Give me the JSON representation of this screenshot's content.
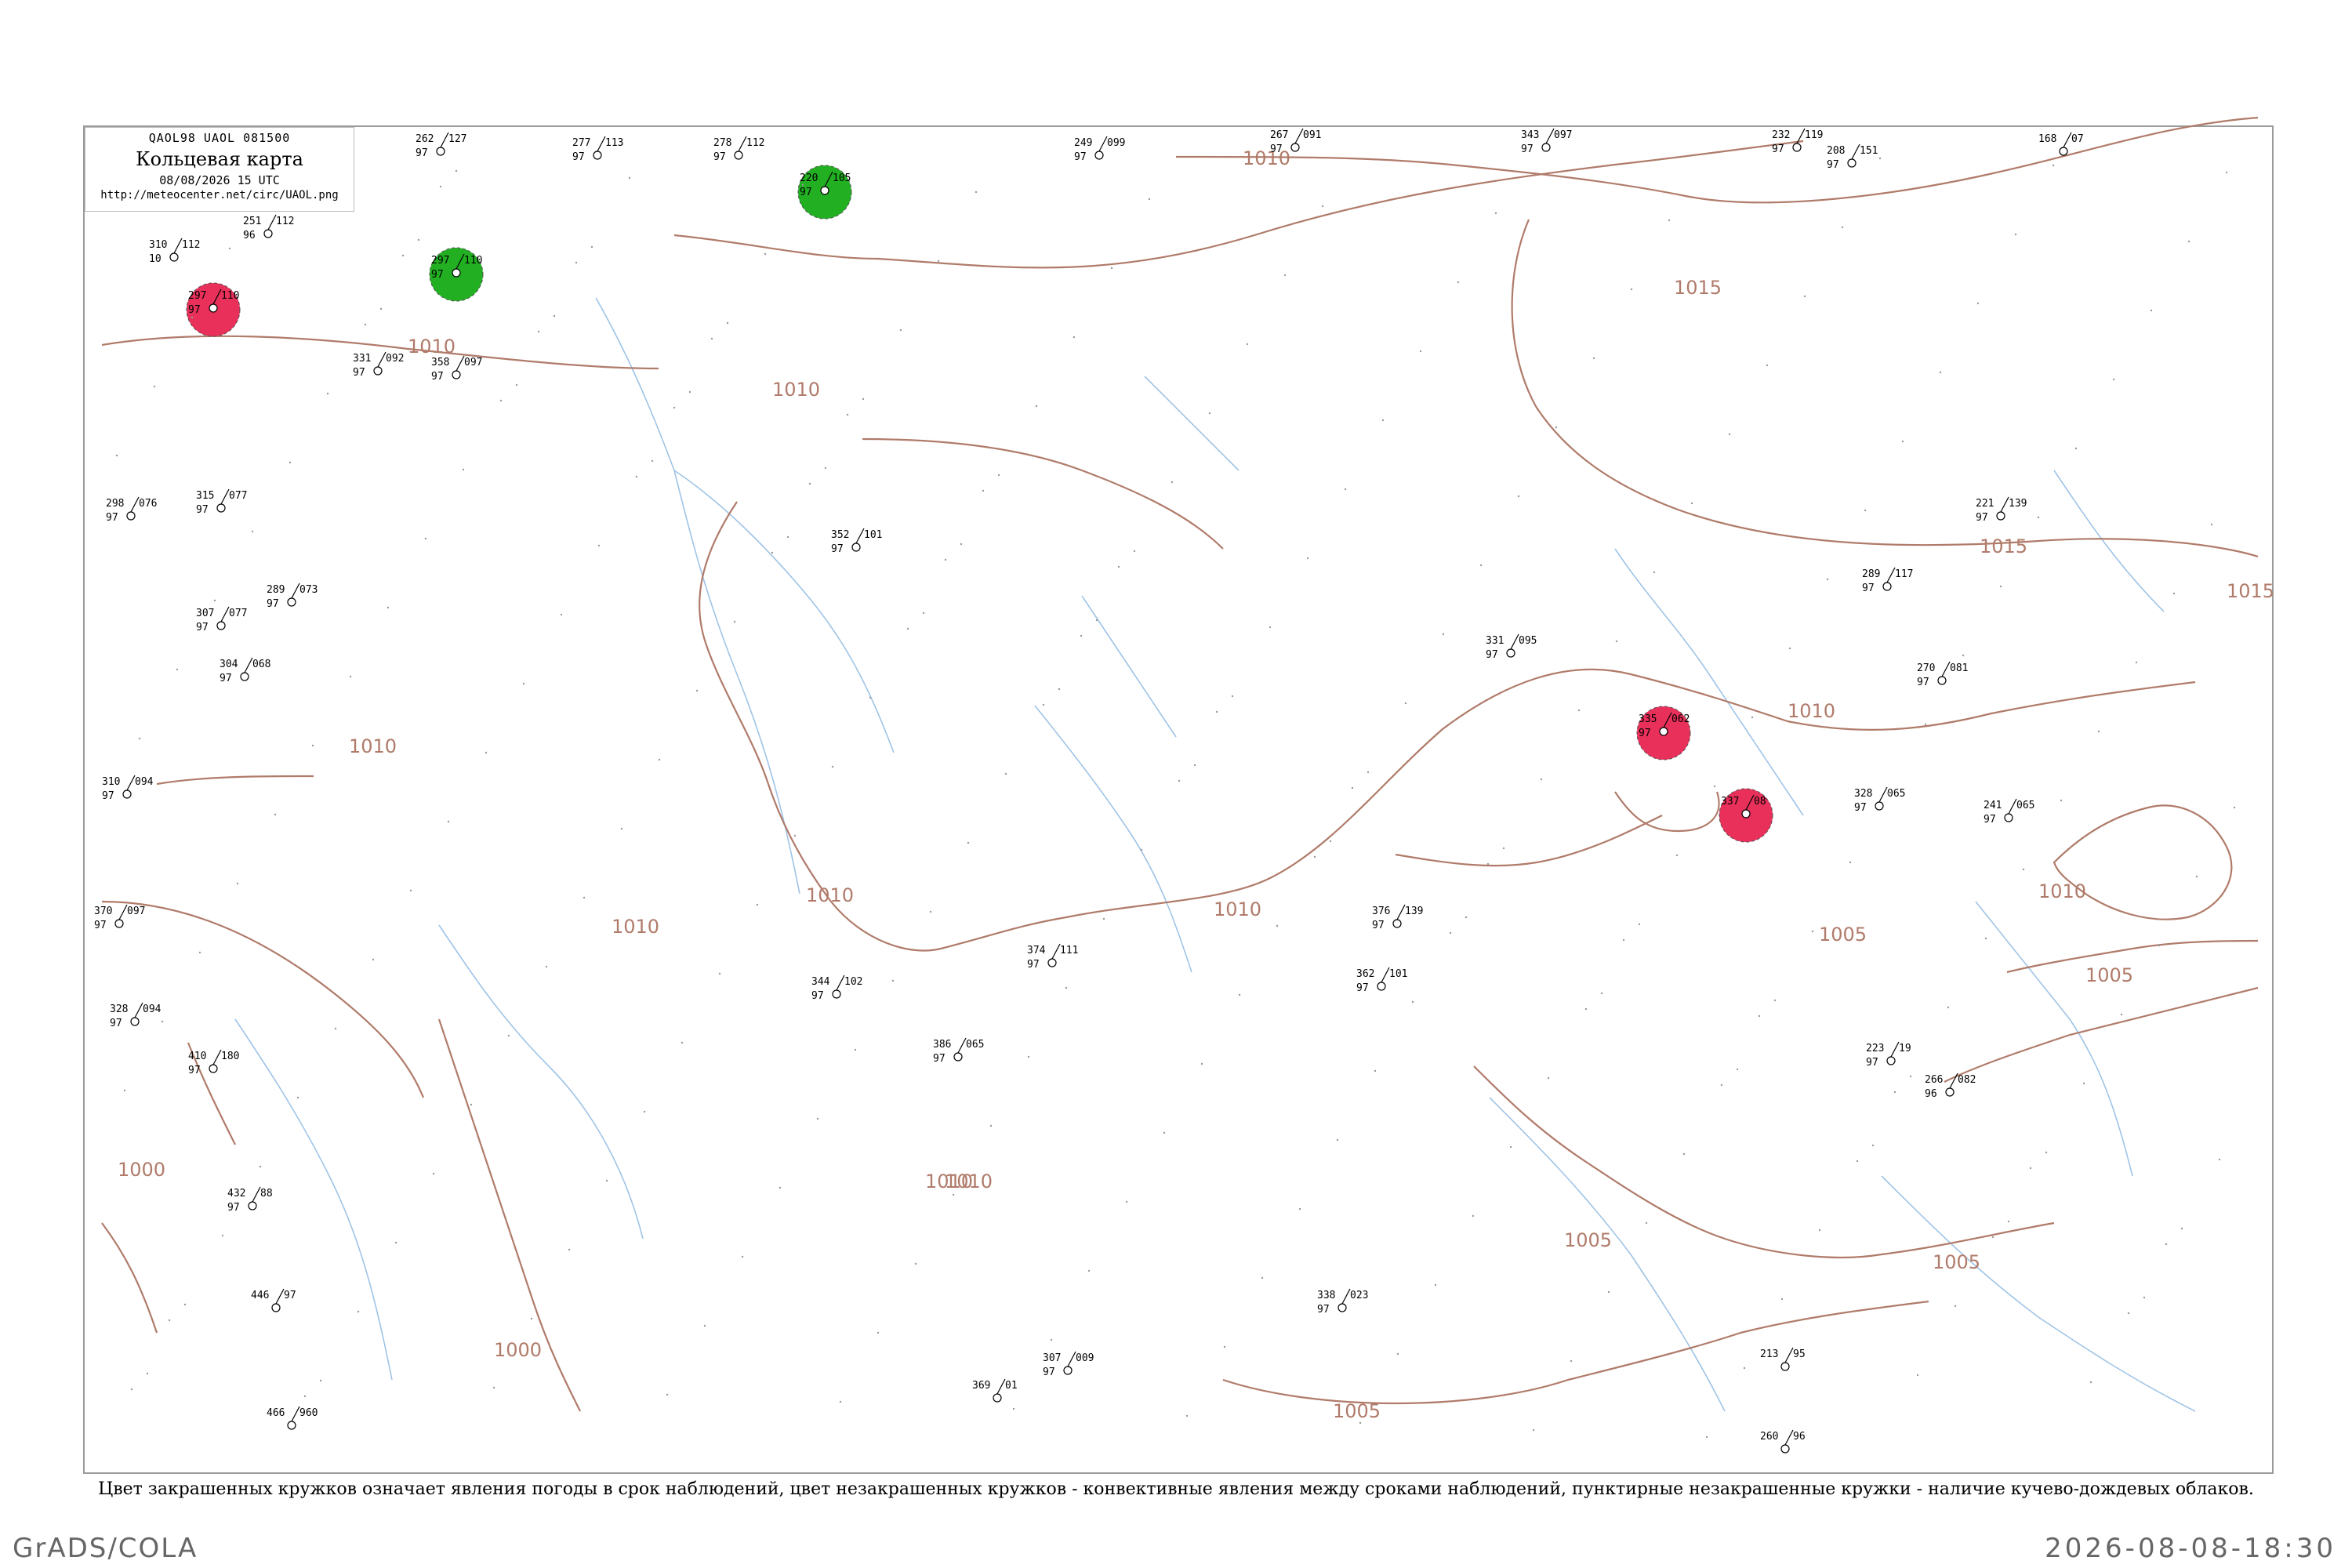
{
  "header": {
    "codes": "QAOL98  UAOL  081500",
    "title": "Кольцевая карта",
    "datetime": "08/08/2026 15 UTC",
    "url": "http://meteocenter.net/circ/UAOL.png"
  },
  "caption": "Цвет закрашенных кружков означает явления погоды в срок наблюдений, цвет незакрашенных кружков - конвективные явления между сроками наблюдений, пунктирные незакрашенные кружки - наличие кучево-дождевых облаков.",
  "footer": {
    "left": "GrADS/COLA",
    "right": "2026-08-08-18:30"
  },
  "colors": {
    "isobar": "#b07b6a",
    "river": "#9fc4e6",
    "border": "#999999",
    "thunder_fill": "#e8305a",
    "rain_fill": "#22b022",
    "cb_circle": "#22b022",
    "conv_circle": "#d84a6a"
  },
  "isobars": [
    {
      "label": "1010"
    },
    {
      "label": "1010"
    },
    {
      "label": "1010"
    },
    {
      "label": "1010"
    },
    {
      "label": "1010"
    },
    {
      "label": "1010"
    },
    {
      "label": "1010"
    },
    {
      "label": "1010"
    },
    {
      "label": "1015"
    },
    {
      "label": "1015"
    },
    {
      "label": "1015"
    },
    {
      "label": "1010"
    },
    {
      "label": "1005"
    },
    {
      "label": "1005"
    },
    {
      "label": "1005"
    },
    {
      "label": "1005"
    },
    {
      "label": "1005"
    },
    {
      "label": "1000"
    },
    {
      "label": "1000"
    },
    {
      "label": "1010"
    },
    {
      "label": "1010"
    }
  ],
  "stations": [
    {
      "p": "310",
      "t": "112",
      "td": "10",
      "name": "",
      "wx": "none"
    },
    {
      "p": "251",
      "t": "112",
      "td": "96",
      "name": "",
      "wx": "none"
    },
    {
      "p": "297",
      "t": "110",
      "td": "97",
      "name": "",
      "wx": "thunder"
    },
    {
      "p": "262",
      "t": "127",
      "td": "97",
      "name": "",
      "wx": "none"
    },
    {
      "p": "277",
      "t": "113",
      "td": "97",
      "name": "",
      "wx": "none"
    },
    {
      "p": "297",
      "t": "110",
      "td": "97",
      "name": "",
      "wx": "rain"
    },
    {
      "p": "278",
      "t": "112",
      "td": "97",
      "name": "",
      "wx": "none"
    },
    {
      "p": "220",
      "t": "105",
      "td": "97",
      "name": "",
      "wx": "rain"
    },
    {
      "p": "249",
      "t": "099",
      "td": "97",
      "name": "",
      "wx": "none"
    },
    {
      "p": "267",
      "t": "091",
      "td": "97",
      "name": "",
      "wx": "none"
    },
    {
      "p": "343",
      "t": "097",
      "td": "97",
      "name": "",
      "wx": "none"
    },
    {
      "p": "232",
      "t": "119",
      "td": "97",
      "name": "",
      "wx": "none"
    },
    {
      "p": "208",
      "t": "151",
      "td": "97",
      "name": "",
      "wx": "none"
    },
    {
      "p": "168",
      "t": "07",
      "td": "",
      "name": "",
      "wx": "none"
    },
    {
      "p": "331",
      "t": "092",
      "td": "97",
      "name": "",
      "wx": "none"
    },
    {
      "p": "358",
      "t": "097",
      "td": "97",
      "name": "",
      "wx": "none"
    },
    {
      "p": "298",
      "t": "076",
      "td": "97",
      "name": "",
      "wx": "none"
    },
    {
      "p": "315",
      "t": "077",
      "td": "97",
      "name": "",
      "wx": "none"
    },
    {
      "p": "289",
      "t": "073",
      "td": "97",
      "name": "",
      "wx": "none"
    },
    {
      "p": "307",
      "t": "077",
      "td": "97",
      "name": "",
      "wx": "none"
    },
    {
      "p": "304",
      "t": "068",
      "td": "97",
      "name": "",
      "wx": "none"
    },
    {
      "p": "310",
      "t": "094",
      "td": "97",
      "name": "",
      "wx": "none"
    },
    {
      "p": "328",
      "t": "094",
      "td": "97",
      "name": "",
      "wx": "none"
    },
    {
      "p": "370",
      "t": "097",
      "td": "97",
      "name": "",
      "wx": "none"
    },
    {
      "p": "410",
      "t": "180",
      "td": "97",
      "name": "",
      "wx": "none"
    },
    {
      "p": "432",
      "t": "88",
      "td": "97",
      "name": "",
      "wx": "none"
    },
    {
      "p": "446",
      "t": "97",
      "td": "",
      "name": "",
      "wx": "none"
    },
    {
      "p": "466",
      "t": "960",
      "td": "",
      "name": "",
      "wx": "none"
    },
    {
      "p": "352",
      "t": "101",
      "td": "97",
      "name": "",
      "wx": "none"
    },
    {
      "p": "344",
      "t": "102",
      "td": "97",
      "name": "",
      "wx": "none"
    },
    {
      "p": "386",
      "t": "065",
      "td": "97",
      "name": "",
      "wx": "none"
    },
    {
      "p": "369",
      "t": "01",
      "td": "",
      "name": "",
      "wx": "none"
    },
    {
      "p": "307",
      "t": "009",
      "td": "97",
      "name": "",
      "wx": "none"
    },
    {
      "p": "374",
      "t": "111",
      "td": "97",
      "name": "",
      "wx": "none"
    },
    {
      "p": "362",
      "t": "101",
      "td": "97",
      "name": "",
      "wx": "none"
    },
    {
      "p": "376",
      "t": "139",
      "td": "97",
      "name": "",
      "wx": "none"
    },
    {
      "p": "338",
      "t": "023",
      "td": "97",
      "name": "",
      "wx": "none"
    },
    {
      "p": "331",
      "t": "095",
      "td": "97",
      "name": "",
      "wx": "none"
    },
    {
      "p": "335",
      "t": "062",
      "td": "97",
      "name": "",
      "wx": "thunder"
    },
    {
      "p": "337",
      "t": "08",
      "td": "",
      "name": "",
      "wx": "thunder"
    },
    {
      "p": "328",
      "t": "065",
      "td": "97",
      "name": "",
      "wx": "none"
    },
    {
      "p": "270",
      "t": "081",
      "td": "97",
      "name": "",
      "wx": "none"
    },
    {
      "p": "241",
      "t": "065",
      "td": "97",
      "name": "",
      "wx": "none"
    },
    {
      "p": "289",
      "t": "117",
      "td": "97",
      "name": "",
      "wx": "none"
    },
    {
      "p": "221",
      "t": "139",
      "td": "97",
      "name": "",
      "wx": "none"
    },
    {
      "p": "223",
      "t": "19",
      "td": "97",
      "name": "",
      "wx": "none"
    },
    {
      "p": "266",
      "t": "082",
      "td": "96",
      "name": "",
      "wx": "none"
    },
    {
      "p": "213",
      "t": "95",
      "td": "",
      "name": "",
      "wx": "none"
    },
    {
      "p": "260",
      "t": "96",
      "td": "",
      "name": "",
      "wx": "none"
    }
  ]
}
